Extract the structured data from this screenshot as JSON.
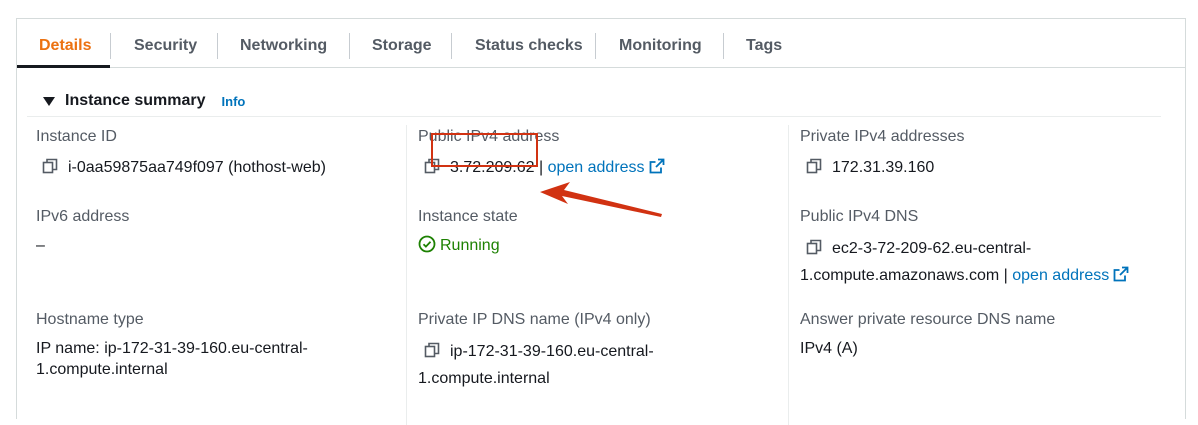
{
  "tabs": [
    {
      "label": "Details",
      "active": true
    },
    {
      "label": "Security"
    },
    {
      "label": "Networking"
    },
    {
      "label": "Storage"
    },
    {
      "label": "Status checks"
    },
    {
      "label": "Monitoring"
    },
    {
      "label": "Tags"
    }
  ],
  "summary": {
    "title": "Instance summary",
    "info": "Info"
  },
  "fields": {
    "instance_id": {
      "label": "Instance ID",
      "value": "i-0aa59875aa749f097 (hothost-web)"
    },
    "public_ipv4": {
      "label": "Public IPv4 address",
      "value": "3.72.209.62",
      "sep": " |",
      "link": "open address"
    },
    "private_ipv4": {
      "label": "Private IPv4 addresses",
      "value": "172.31.39.160"
    },
    "ipv6": {
      "label": "IPv6 address",
      "value": "–"
    },
    "instance_state": {
      "label": "Instance state",
      "value": "Running"
    },
    "public_dns": {
      "label": "Public IPv4 DNS",
      "value_line1": "ec2-3-72-209-62.eu-central-",
      "value_line2": "1.compute.amazonaws.com",
      "sep": " | ",
      "link": "open address"
    },
    "hostname_type": {
      "label": "Hostname type",
      "value_line1": "IP name: ip-172-31-39-160.eu-central-",
      "value_line2": "1.compute.internal"
    },
    "private_dns": {
      "label": "Private IP DNS name (IPv4 only)",
      "value_line1": "ip-172-31-39-160.eu-central-",
      "value_line2": "1.compute.internal"
    },
    "answer_dns": {
      "label": "Answer private resource DNS name",
      "value": "IPv4 (A)"
    }
  },
  "colors": {
    "accent": "#ec7211",
    "link": "#0073bb",
    "running": "#1d8102",
    "annotation": "#d13212"
  },
  "icons": [
    "copy-icon",
    "external-link-icon",
    "check-circle-icon",
    "caret-down-icon",
    "annotation-arrow"
  ]
}
